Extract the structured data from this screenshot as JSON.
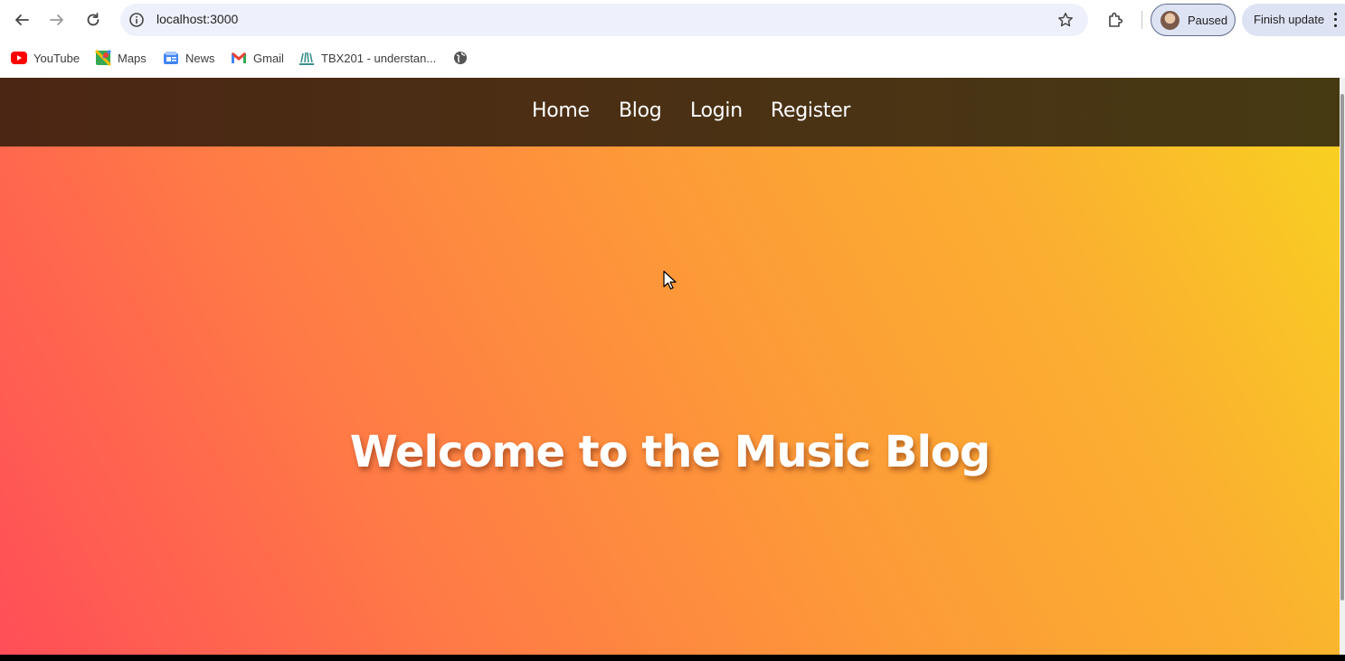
{
  "browser": {
    "url": "localhost:3000",
    "profile_label": "Paused",
    "update_label": "Finish update",
    "icons": {
      "back": "back-arrow-icon",
      "forward": "forward-arrow-icon",
      "reload": "reload-icon",
      "site_info": "info-icon",
      "bookmark_star": "star-icon",
      "extensions": "puzzle-icon",
      "menu": "kebab-menu-icon"
    }
  },
  "bookmarks": [
    {
      "label": "YouTube",
      "icon": "youtube-icon"
    },
    {
      "label": "Maps",
      "icon": "maps-icon"
    },
    {
      "label": "News",
      "icon": "news-icon"
    },
    {
      "label": "Gmail",
      "icon": "gmail-icon"
    },
    {
      "label": "TBX201 - understan...",
      "icon": "tbx-icon"
    },
    {
      "label": "",
      "icon": "globe-icon"
    }
  ],
  "site": {
    "nav": [
      "Home",
      "Blog",
      "Login",
      "Register"
    ],
    "hero_title": "Welcome to the Music Blog"
  },
  "colors": {
    "nav_bg": "#4b2c14",
    "gradient_start": "#ff4e58",
    "gradient_mid": "#fd9a38",
    "gradient_end": "#f8d320",
    "omnibox_bg": "#eef1fb"
  }
}
